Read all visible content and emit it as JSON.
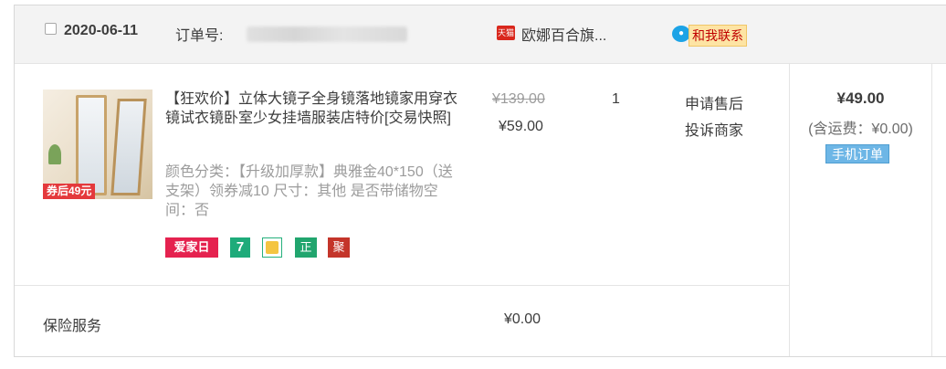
{
  "header": {
    "date": "2020-06-11",
    "order_label": "订单号:",
    "shop_badge": "天猫",
    "shop_name": "欧娜百合旗...",
    "contact_label": "和我联系"
  },
  "item": {
    "promo_tag": "券后49元",
    "title": "【狂欢价】立体大镜子全身镜落地镜家用穿衣镜试衣镜卧室少女挂墙服装店特价[交易快照]",
    "sku": "颜色分类：【升级加厚款】典雅金40*150（送支架）领券减10 尺寸：其他 是否带储物空间：否",
    "badges": {
      "b1": "爱家日",
      "b2": "7",
      "b4": "正",
      "b5": "聚"
    },
    "original_price": "¥139.00",
    "price": "¥59.00",
    "quantity": "1",
    "after_sale": "申请售后",
    "complain": "投诉商家"
  },
  "summary": {
    "total": "¥49.00",
    "shipping": "(含运费：¥0.00)",
    "mobile_order": "手机订单"
  },
  "insurance": {
    "label": "保险服务",
    "price": "¥0.00"
  }
}
